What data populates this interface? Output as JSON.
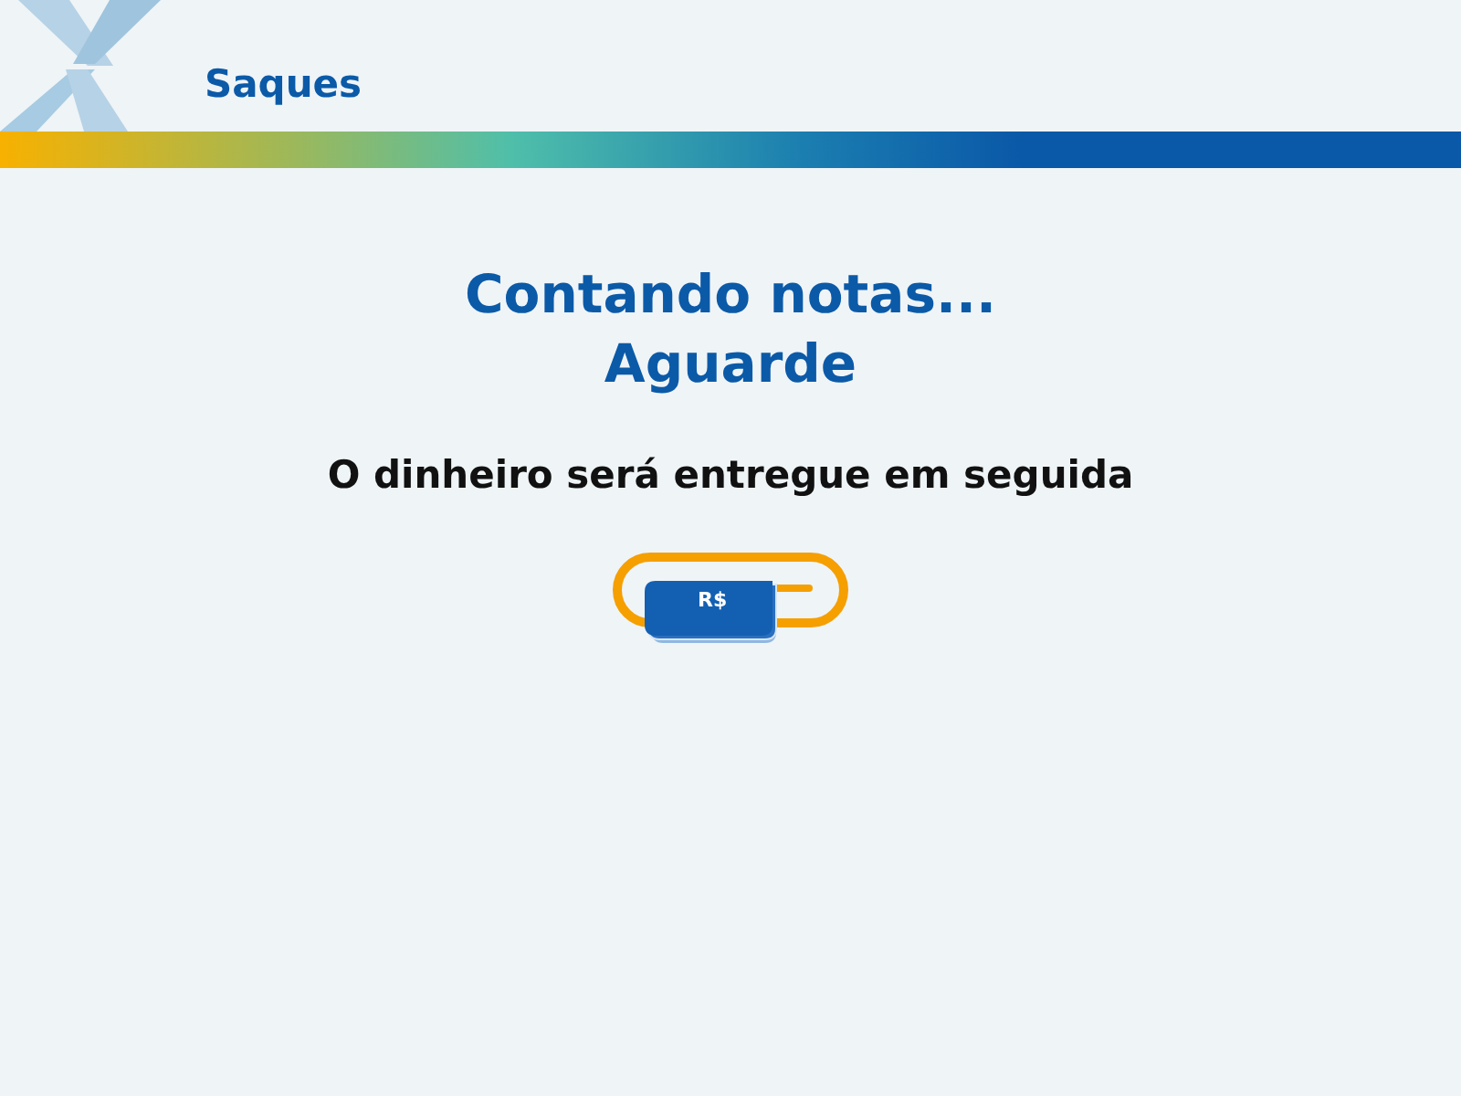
{
  "header": {
    "title": "Saques"
  },
  "message": {
    "heading_lines": [
      "Contando notas...",
      "Aguarde"
    ],
    "subtitle": "O dinheiro será entregue em seguida"
  },
  "dispenser": {
    "note_label": "R$"
  }
}
